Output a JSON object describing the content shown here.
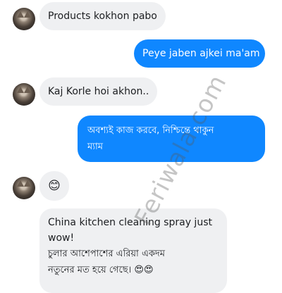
{
  "messages": [
    {
      "side": "in",
      "text": "Products kokhon pabo"
    },
    {
      "side": "out",
      "text": "Peye jaben ajkei ma'am"
    },
    {
      "side": "in",
      "text": "Kaj Korle hoi akhon.."
    },
    {
      "side": "out",
      "text": "অবশ্যই কাজ করবে, নিশ্চিন্তে থাকুন ম্যাম",
      "line1": "অবশ্যই কাজ করবে, নিশ্চিন্তে থাকুন",
      "line2": "ম্যাম"
    },
    {
      "side": "in",
      "text": "😊"
    },
    {
      "side": "in",
      "line1": "China kitchen cleaning spray just",
      "line2": "wow!",
      "line3": "চুলার আশেপাশের এরিয়া একদম",
      "line4": "নতুনের মত হয়ে গেছে। 😍😍"
    }
  ],
  "watermark": "Feriwala.com",
  "colors": {
    "incoming_bubble": "#eff0f2",
    "outgoing_bubble": "#0f87ff",
    "text_dark": "#1c1e21"
  }
}
